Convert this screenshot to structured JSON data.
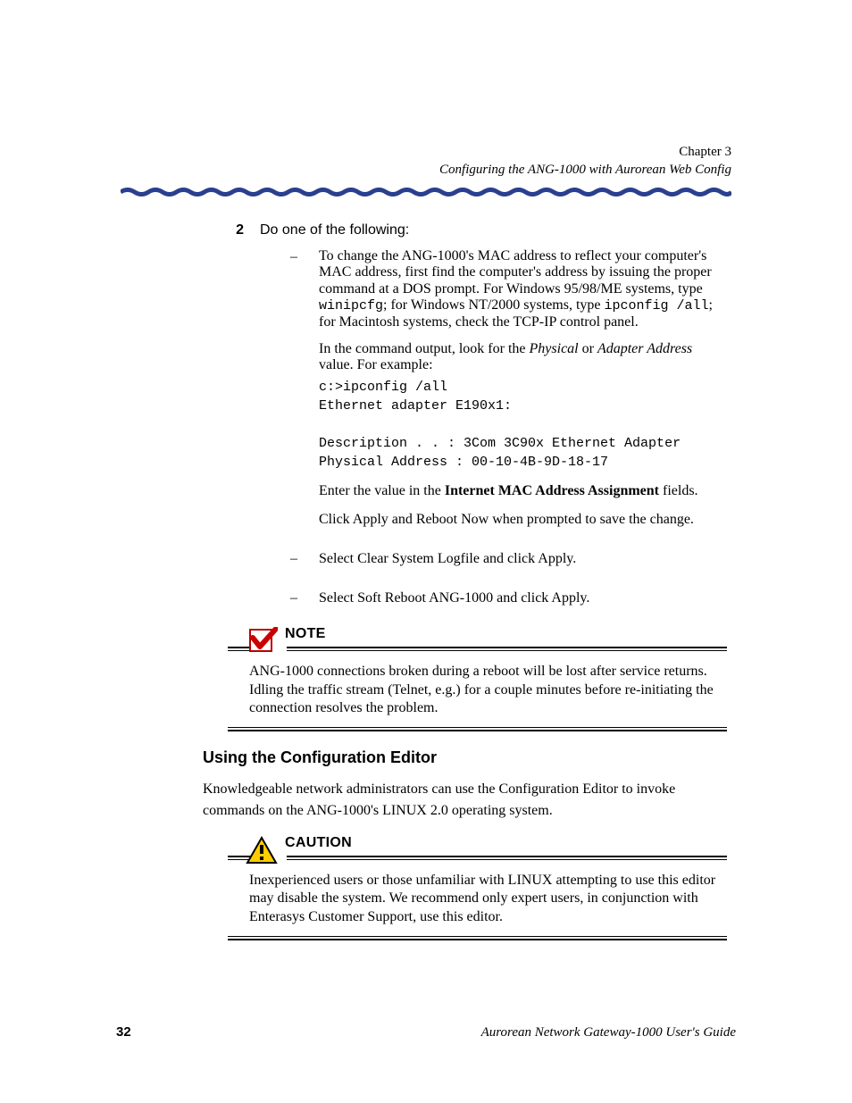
{
  "header": {
    "chapter": "Chapter 3",
    "subtitle": "Configuring the ANG-1000 with Aurorean Web Config"
  },
  "step": {
    "number": "2",
    "text": "Do one of the following:"
  },
  "bullets": {
    "b1": {
      "para1_a": "To change the ANG-1000's MAC address to reflect your computer's MAC address, first find the computer's address by issuing the proper command at a DOS prompt. For Windows 95/98/ME systems, type ",
      "cmd1": "winipcfg",
      "para1_b": "; for Windows NT/2000 systems, type ",
      "cmd2": "ipconfig /all",
      "para1_c": "; for Macintosh systems, check the TCP-IP control panel.",
      "para2_a": "In the command output, look for the ",
      "it1": "Physical",
      "para2_b": " or ",
      "it2": "Adapter Address",
      "para2_c": " value. For example:",
      "pre": "c:>ipconfig /all\nEthernet adapter E190x1:\n\nDescription . . : 3Com 3C90x Ethernet Adapter\nPhysical Address : 00-10-4B-9D-18-17",
      "para3_a": "Enter the value in the ",
      "bold": "Internet MAC Address Assignment",
      "para3_b": " fields.",
      "para4": "Click Apply and Reboot Now when prompted to save the change."
    },
    "b2": "Select Clear System Logfile and click Apply.",
    "b3": "Select Soft Reboot ANG-1000 and click Apply."
  },
  "note": {
    "label": "NOTE",
    "body": "ANG-1000 connections broken during a reboot will be lost after service returns. Idling the traffic stream (Telnet, e.g.) for a couple minutes before re-initiating the connection resolves the problem."
  },
  "section": {
    "heading": "Using the Configuration Editor",
    "para": "Knowledgeable network administrators can use the Configuration Editor to invoke commands on the ANG-1000's LINUX 2.0 operating system."
  },
  "caution": {
    "label": "CAUTION",
    "body": "Inexperienced users or those unfamiliar with LINUX attempting to use this editor may disable the system. We recommend only expert users, in conjunction with Enterasys Customer Support, use this editor."
  },
  "footer": {
    "page": "32",
    "title": "Aurorean Network Gateway-1000 User's Guide"
  }
}
